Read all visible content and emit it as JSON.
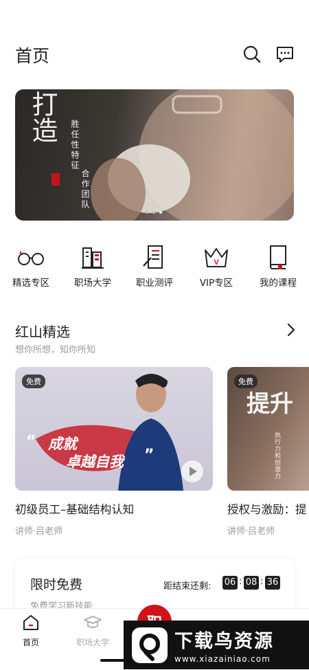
{
  "header": {
    "title": "首页",
    "search_icon": "search-icon",
    "message_icon": "message-icon"
  },
  "banner": {
    "calligraphy_big": "打造",
    "calligraphy_col1": "胜任性特征",
    "calligraphy_col2": "合作团队",
    "dots": 3,
    "active_dot": 2
  },
  "quick_nav": [
    {
      "label": "精选专区",
      "icon": "glasses-icon"
    },
    {
      "label": "职场大学",
      "icon": "building-icon"
    },
    {
      "label": "职业测评",
      "icon": "document-pen-icon"
    },
    {
      "label": "VIP专区",
      "icon": "crown-icon"
    },
    {
      "label": "我的课程",
      "icon": "book-icon"
    }
  ],
  "section": {
    "title": "红山精选",
    "subtitle": "想你所想，知你所知"
  },
  "cards": [
    {
      "badge": "免费",
      "overlay_line1": "成就",
      "overlay_line2": "卓越自我",
      "title": "初级员工–基础结构认知",
      "teacher": "讲师·吕老师"
    },
    {
      "badge": "免费",
      "overlay_big": "提升",
      "overlay_small": "执行力和创造力",
      "title": "授权与激励：提",
      "teacher": "讲师·吕老师"
    }
  ],
  "limited": {
    "title": "限时免费",
    "subtitle": "免费学习新技能",
    "countdown_label": "距结束还剩:",
    "hours": "06",
    "minutes": "08",
    "seconds": "36"
  },
  "tabbar": {
    "home_label": "首页",
    "college_label": "职场大学",
    "center_label": "职"
  },
  "watermark": {
    "name": "下载鸟资源",
    "url": "www.xiazainiao.com"
  },
  "colors": {
    "accent": "#d0121b",
    "text": "#222222",
    "muted": "#999999"
  }
}
